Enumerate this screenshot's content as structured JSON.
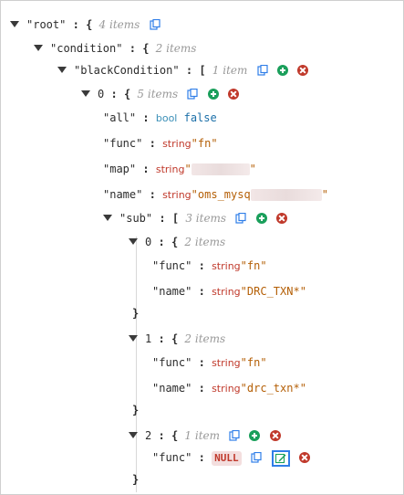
{
  "tree": {
    "root": {
      "key": "root",
      "open": "{",
      "count": "4 items"
    },
    "condition": {
      "key": "condition",
      "open": "{",
      "count": "2 items"
    },
    "blackCondition": {
      "key": "blackCondition",
      "open": "[",
      "count": "1 item"
    },
    "item0": {
      "key": "0",
      "open": "{",
      "count": "5 items"
    },
    "all": {
      "key": "all",
      "type": "bool",
      "value": "false"
    },
    "func": {
      "key": "func",
      "type": "string",
      "value": "fn"
    },
    "map": {
      "key": "map",
      "type": "string",
      "value": ""
    },
    "name": {
      "key": "name",
      "type": "string",
      "value": "oms_mysq"
    },
    "sub": {
      "key": "sub",
      "open": "[",
      "count": "3 items"
    },
    "sub0": {
      "key": "0",
      "open": "{",
      "count": "2 items",
      "func": {
        "key": "func",
        "type": "string",
        "value": "fn"
      },
      "name": {
        "key": "name",
        "type": "string",
        "value": "DRC_TXN*"
      }
    },
    "sub1": {
      "key": "1",
      "open": "{",
      "count": "2 items",
      "func": {
        "key": "func",
        "type": "string",
        "value": "fn"
      },
      "name": {
        "key": "name",
        "type": "string",
        "value": "drc_txn*"
      }
    },
    "sub2": {
      "key": "2",
      "open": "{",
      "count": "1 item",
      "func": {
        "key": "func",
        "null_label": "NULL"
      }
    },
    "close_brace": "}",
    "colon": ":"
  },
  "colors": {
    "add": "#1a9f5b",
    "remove": "#c0392b",
    "highlight": "#2f7ee8"
  },
  "icons": [
    "copy-icon",
    "add-icon",
    "remove-icon",
    "edit-icon",
    "expand-triangle-icon"
  ]
}
